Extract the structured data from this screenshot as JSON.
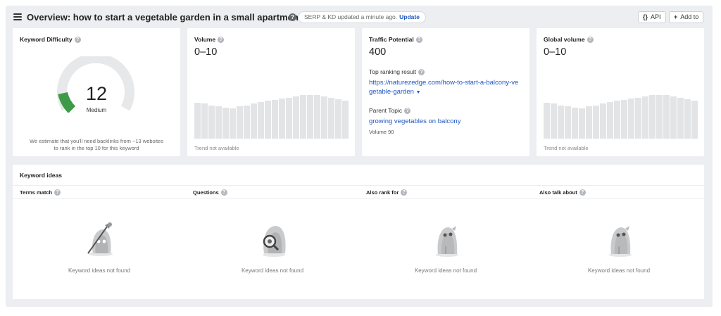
{
  "header": {
    "title": "Overview: how to start a vegetable garden in a small apartment balcony",
    "serp_status": "SERP & KD updated a minute ago.",
    "update_label": "Update",
    "api_icon": "{}",
    "api_label": "API",
    "add_icon": "+",
    "add_label": "Add to"
  },
  "keyword_difficulty": {
    "label": "Keyword Difficulty",
    "value": "12",
    "fill_fraction": 0.12,
    "level": "Medium",
    "note_line1": "We estimate that you'll need backlinks from ~13 websites",
    "note_line2": "to rank in the top 10 for this keyword",
    "accent_color": "#3d9b47"
  },
  "volume": {
    "label": "Volume",
    "value": "0–10",
    "trend_note": "Trend not available",
    "trend_bars": [
      0.76,
      0.74,
      0.7,
      0.68,
      0.65,
      0.64,
      0.68,
      0.7,
      0.74,
      0.77,
      0.8,
      0.82,
      0.85,
      0.87,
      0.9,
      0.92,
      0.93,
      0.92,
      0.9,
      0.87,
      0.84,
      0.8
    ]
  },
  "traffic_potential": {
    "label": "Traffic Potential",
    "value": "400",
    "top_ranking_label": "Top ranking result",
    "top_ranking_url_line1": "https://naturezedge.com/how-to-start-a-balcony-ve",
    "top_ranking_url_line2": "getable-garden",
    "parent_topic_label": "Parent Topic",
    "parent_topic_value": "growing vegetables on balcony",
    "parent_volume": "Volume 90"
  },
  "global_volume": {
    "label": "Global volume",
    "value": "0–10",
    "trend_note": "Trend not available",
    "trend_bars": [
      0.76,
      0.74,
      0.7,
      0.68,
      0.65,
      0.64,
      0.68,
      0.7,
      0.74,
      0.77,
      0.8,
      0.82,
      0.85,
      0.87,
      0.9,
      0.92,
      0.93,
      0.92,
      0.9,
      0.87,
      0.84,
      0.8
    ]
  },
  "keyword_ideas": {
    "title": "Keyword ideas",
    "columns": [
      {
        "label": "Terms match",
        "empty": "Keyword ideas not found",
        "icon": "ghost-broom-icon"
      },
      {
        "label": "Questions",
        "empty": "Keyword ideas not found",
        "icon": "ghost-magnifier-icon"
      },
      {
        "label": "Also rank for",
        "empty": "Keyword ideas not found",
        "icon": "ghost-icon"
      },
      {
        "label": "Also talk about",
        "empty": "Keyword ideas not found",
        "icon": "ghost-icon"
      }
    ]
  }
}
